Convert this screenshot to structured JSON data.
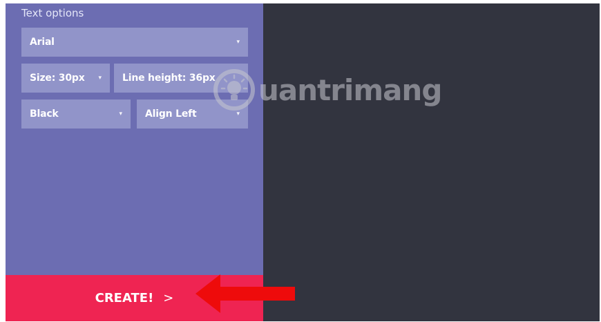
{
  "sidebar": {
    "section_title": "Text options",
    "font": {
      "value": "Arial"
    },
    "size": {
      "value": "Size: 30px"
    },
    "line_height": {
      "value": "Line height: 36px"
    },
    "color": {
      "value": "Black"
    },
    "align": {
      "value": "Align Left"
    },
    "caret_glyph": "▾"
  },
  "create_button": {
    "label": "CREATE!",
    "chevron": ">"
  },
  "watermark": {
    "text": "uantrimang",
    "icon": "lightbulb-logo"
  },
  "colors": {
    "sidebar_bg": "#6c6db2",
    "field_bg": "#9194c9",
    "preview_bg": "#32343f",
    "create_bg": "#ef2452",
    "annotation_arrow": "#ee0b0b"
  }
}
